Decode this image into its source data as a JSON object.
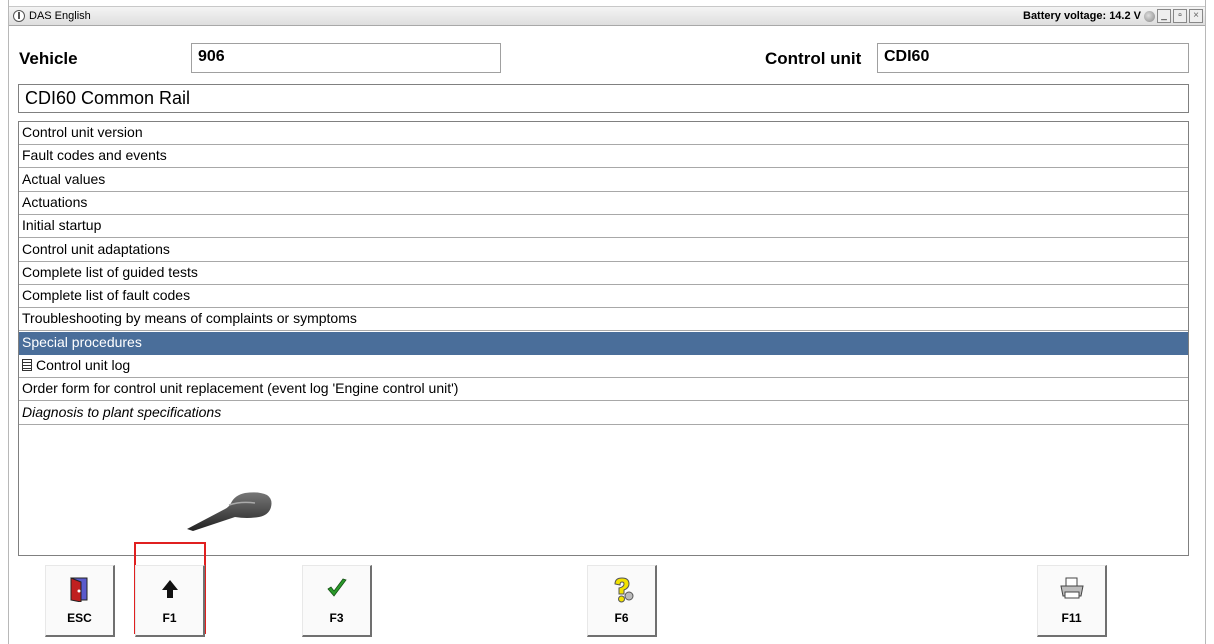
{
  "window": {
    "title": "DAS English",
    "battery_label": "Battery voltage: 14.2 V",
    "min_label": "_",
    "max_label": "▫",
    "close_label": "×"
  },
  "header": {
    "vehicle_label": "Vehicle",
    "vehicle_value": "906",
    "control_unit_label": "Control unit",
    "control_unit_value": "CDI60"
  },
  "subtitle": "CDI60 Common Rail",
  "menu": {
    "selected_index": 9,
    "items": [
      {
        "label": "Control unit version",
        "style": "normal"
      },
      {
        "label": "Fault codes and events",
        "style": "normal"
      },
      {
        "label": "Actual values",
        "style": "normal"
      },
      {
        "label": "Actuations",
        "style": "normal"
      },
      {
        "label": "Initial startup",
        "style": "normal"
      },
      {
        "label": "Control unit adaptations",
        "style": "normal"
      },
      {
        "label": "Complete list of guided tests",
        "style": "normal"
      },
      {
        "label": "Complete list of fault codes",
        "style": "normal"
      },
      {
        "label": "Troubleshooting by means of complaints or symptoms",
        "style": "normal"
      },
      {
        "label": "Special procedures",
        "style": "selected"
      },
      {
        "label": "Control unit log",
        "style": "document"
      },
      {
        "label": "Order form for control unit replacement (event log 'Engine control unit')",
        "style": "normal"
      },
      {
        "label": "Diagnosis to plant specifications",
        "style": "italic"
      }
    ]
  },
  "function_keys": [
    {
      "key": "ESC",
      "icon": "exit-door-icon"
    },
    {
      "key": "F1",
      "icon": "up-arrow-icon",
      "highlighted": true
    },
    {
      "key": "F3",
      "icon": "checkmark-icon"
    },
    {
      "key": "F6",
      "icon": "help-question-icon"
    },
    {
      "key": "F11",
      "icon": "printer-icon"
    }
  ],
  "colors": {
    "selection": "#4a6e9a",
    "highlight_box": "#e02020"
  }
}
